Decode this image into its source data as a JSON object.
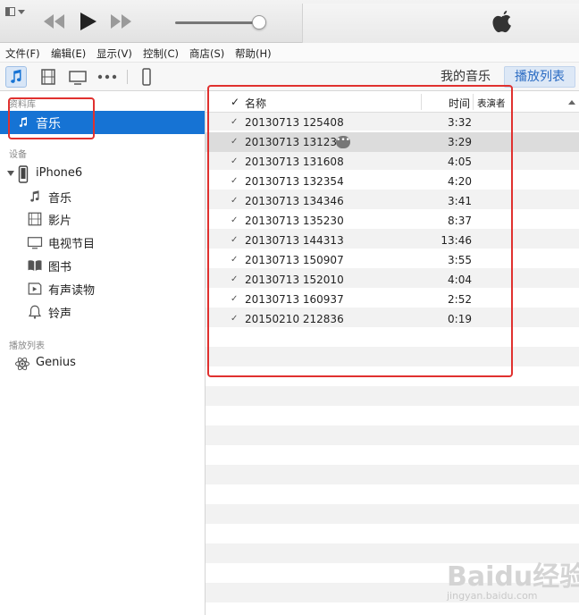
{
  "colors": {
    "accent": "#1673d4",
    "highlight_frame": "#e0312f",
    "selected_row": "#dcdcdc",
    "tab_active_text": "#2a6bc3"
  },
  "menu": [
    "文件(F)",
    "编辑(E)",
    "显示(V)",
    "控制(C)",
    "商店(S)",
    "帮助(H)"
  ],
  "toolbar": {
    "icons": [
      "music-note-icon",
      "film-icon",
      "tv-icon",
      "more-dots-icon",
      "iphone-icon"
    ],
    "tabs": {
      "my_music": "我的音乐",
      "playlist": "播放列表"
    }
  },
  "sidebar": {
    "library_heading": "资料库",
    "library_item": "音乐",
    "devices_heading": "设备",
    "device_name": "iPhone6",
    "device_items": [
      {
        "label": "音乐",
        "icon": "music-note-icon"
      },
      {
        "label": "影片",
        "icon": "film-icon"
      },
      {
        "label": "电视节目",
        "icon": "tv-icon"
      },
      {
        "label": "图书",
        "icon": "book-icon"
      },
      {
        "label": "有声读物",
        "icon": "audiobook-icon"
      },
      {
        "label": "铃声",
        "icon": "bell-icon"
      }
    ],
    "playlists_heading": "播放列表",
    "genius": "Genius"
  },
  "list": {
    "headers": {
      "check": "✓",
      "name": "名称",
      "time": "时间",
      "artist": "表演者"
    },
    "rows": [
      {
        "name": "20130713 125408",
        "time": "3:32"
      },
      {
        "name": "20130713 131230",
        "time": "3:29",
        "selected": true
      },
      {
        "name": "20130713 131608",
        "time": "4:05"
      },
      {
        "name": "20130713 132354",
        "time": "4:20"
      },
      {
        "name": "20130713 134346",
        "time": "3:41"
      },
      {
        "name": "20130713 135230",
        "time": "8:37"
      },
      {
        "name": "20130713 144313",
        "time": "13:46"
      },
      {
        "name": "20130713 150907",
        "time": "3:55"
      },
      {
        "name": "20130713 152010",
        "time": "4:04"
      },
      {
        "name": "20130713 160937",
        "time": "2:52"
      },
      {
        "name": "20150210 212836",
        "time": "0:19"
      }
    ],
    "more_button": "•••"
  },
  "watermark": {
    "brand": "Baidu经验",
    "url": "jingyan.baidu.com"
  }
}
